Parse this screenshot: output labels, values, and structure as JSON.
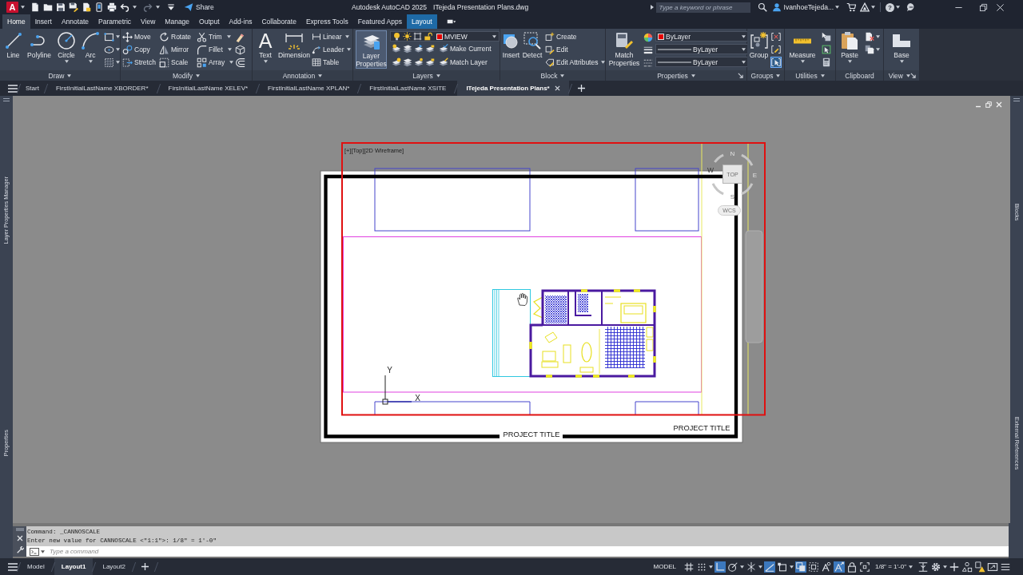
{
  "title_bar": {
    "logo": "A",
    "share": "Share",
    "app_title": "Autodesk AutoCAD 2025",
    "document_title": "ITejeda Presentation Plans.dwg",
    "search": {
      "placeholder": "Type a keyword or phrase"
    },
    "user": "IvanhoeTejeda...",
    "help": "?"
  },
  "ribbon_tabs": [
    {
      "label": "Home",
      "selected": true,
      "kind": "standard"
    },
    {
      "label": "Insert",
      "selected": false,
      "kind": "standard"
    },
    {
      "label": "Annotate",
      "selected": false,
      "kind": "standard"
    },
    {
      "label": "Parametric",
      "selected": false,
      "kind": "standard"
    },
    {
      "label": "View",
      "selected": false,
      "kind": "standard"
    },
    {
      "label": "Manage",
      "selected": false,
      "kind": "standard"
    },
    {
      "label": "Output",
      "selected": false,
      "kind": "standard"
    },
    {
      "label": "Add-ins",
      "selected": false,
      "kind": "standard"
    },
    {
      "label": "Collaborate",
      "selected": false,
      "kind": "standard"
    },
    {
      "label": "Express Tools",
      "selected": false,
      "kind": "standard"
    },
    {
      "label": "Featured Apps",
      "selected": false,
      "kind": "standard"
    },
    {
      "label": "Layout",
      "selected": false,
      "kind": "contextual"
    }
  ],
  "ribbon_panels": [
    {
      "title": "Draw",
      "expandable": true,
      "launcher": false,
      "tools": [
        "Line",
        "Polyline",
        "Circle",
        "Arc"
      ]
    },
    {
      "title": "Modify",
      "expandable": true,
      "launcher": false,
      "tools": [
        "Move",
        "Copy",
        "Stretch",
        "Rotate",
        "Mirror",
        "Scale",
        "Trim",
        "Fillet",
        "Array"
      ]
    },
    {
      "title": "Annotation",
      "expandable": true,
      "launcher": false,
      "text_glyph": "A",
      "tools": [
        "Text",
        "Dimension",
        "Linear",
        "Leader",
        "Table"
      ]
    },
    {
      "title": "Layers",
      "expandable": true,
      "launcher": false,
      "tools": [
        {
          "label": "Layer Properties",
          "highlighted": true
        },
        {
          "label": "Make Current",
          "highlighted": false
        },
        {
          "label": "Match Layer",
          "highlighted": false
        }
      ],
      "current_layer": {
        "name": "MVIEW",
        "color": "#e50000"
      }
    },
    {
      "title": "Block",
      "expandable": true,
      "launcher": false,
      "tools": [
        "Insert",
        "Detect",
        "Create",
        "Edit",
        "Edit Attributes"
      ]
    },
    {
      "title": "Properties",
      "expandable": true,
      "launcher": true,
      "tools": [
        "Match Properties"
      ],
      "object_color": {
        "value": "ByLayer",
        "color": "#e50000"
      },
      "lineweight": "ByLayer",
      "linetype": "ByLayer"
    },
    {
      "title": "Groups",
      "expandable": true,
      "launcher": false,
      "tools": [
        "Group"
      ],
      "group_selection_on": true
    },
    {
      "title": "Utilities",
      "expandable": true,
      "launcher": false,
      "tools": [
        "Measure"
      ]
    },
    {
      "title": "Clipboard",
      "expandable": false,
      "launcher": false,
      "tools": [
        "Paste"
      ]
    },
    {
      "title": "View",
      "expandable": true,
      "launcher": true,
      "tools": [
        "Base"
      ]
    }
  ],
  "file_tabs": [
    {
      "label": "Start",
      "selected": false
    },
    {
      "label": "FirstInitialLastName XBORDER*",
      "selected": false
    },
    {
      "label": "FirsInitialLastName XELEV*",
      "selected": false
    },
    {
      "label": "FirstInitialLastName XPLAN*",
      "selected": false
    },
    {
      "label": "FirstInitialLastName XSITE",
      "selected": false
    },
    {
      "label": "ITejeda Presentation Plans*",
      "selected": true
    }
  ],
  "left_palettes": [
    "Layer Properties Manager",
    "Properties"
  ],
  "right_palettes": [
    "Blocks",
    "External References"
  ],
  "drawing": {
    "viewport_label": "[+][Top][2D Wireframe]",
    "sheet_titles": [
      "PROJECT TITLE",
      "PROJECT TITLE"
    ],
    "ucs_axes": [
      "Y",
      "X"
    ],
    "viewcube": {
      "north": "N",
      "west": "W",
      "face": "TOP",
      "east": "E",
      "south": "S",
      "coordinate_system": "WCS"
    }
  },
  "command_line": {
    "history": [
      "Command: _CANNOSCALE",
      "Enter new value for CANNOSCALE <\"1:1\">: 1/8\" = 1'-0\""
    ],
    "placeholder": "Type a command"
  },
  "layout_tabs": [
    {
      "label": "Model",
      "selected": false
    },
    {
      "label": "Layout1",
      "selected": true
    },
    {
      "label": "Layout2",
      "selected": false
    }
  ],
  "status_bar": {
    "space": "MODEL",
    "toggles": [
      {
        "on": false
      },
      {
        "on": false
      },
      {
        "on": true
      },
      {
        "on": false
      },
      {
        "on": false
      },
      {
        "on": true
      },
      {
        "on": false
      },
      {
        "on": true
      },
      {
        "on": false
      },
      {
        "on": false
      },
      {
        "on": true
      },
      {
        "on": false
      },
      {
        "on": false
      }
    ],
    "annotation_scale": "1/8\" = 1'-0\""
  }
}
